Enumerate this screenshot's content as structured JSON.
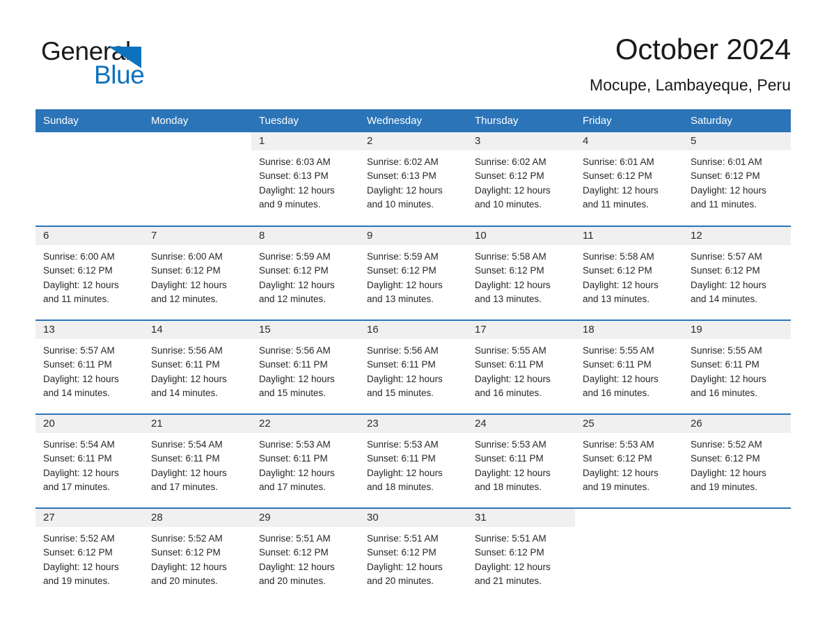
{
  "brand": {
    "logo_line1": "General",
    "logo_line2": "Blue",
    "logo_triangle": "blue-triangle-icon",
    "black": "#1a1a1a",
    "blue": "#0d72bd"
  },
  "header": {
    "month_title": "October 2024",
    "location": "Mocupe, Lambayeque, Peru"
  },
  "theme": {
    "header_blue": "#2b74b8",
    "row_rule_blue": "#2b74b8",
    "daynum_band": "#f0f0f0",
    "cell_bg": "#ffffff",
    "text": "#262626"
  },
  "calendar": {
    "weekday_headers": [
      "Sunday",
      "Monday",
      "Tuesday",
      "Wednesday",
      "Thursday",
      "Friday",
      "Saturday"
    ],
    "weeks": [
      [
        {
          "day": "",
          "lines": [
            "",
            "",
            "",
            ""
          ],
          "blank": true
        },
        {
          "day": "",
          "lines": [
            "",
            "",
            "",
            ""
          ],
          "blank": true
        },
        {
          "day": "1",
          "lines": [
            "Sunrise: 6:03 AM",
            "Sunset: 6:13 PM",
            "Daylight: 12 hours",
            "and 9 minutes."
          ]
        },
        {
          "day": "2",
          "lines": [
            "Sunrise: 6:02 AM",
            "Sunset: 6:13 PM",
            "Daylight: 12 hours",
            "and 10 minutes."
          ]
        },
        {
          "day": "3",
          "lines": [
            "Sunrise: 6:02 AM",
            "Sunset: 6:12 PM",
            "Daylight: 12 hours",
            "and 10 minutes."
          ]
        },
        {
          "day": "4",
          "lines": [
            "Sunrise: 6:01 AM",
            "Sunset: 6:12 PM",
            "Daylight: 12 hours",
            "and 11 minutes."
          ]
        },
        {
          "day": "5",
          "lines": [
            "Sunrise: 6:01 AM",
            "Sunset: 6:12 PM",
            "Daylight: 12 hours",
            "and 11 minutes."
          ]
        }
      ],
      [
        {
          "day": "6",
          "lines": [
            "Sunrise: 6:00 AM",
            "Sunset: 6:12 PM",
            "Daylight: 12 hours",
            "and 11 minutes."
          ]
        },
        {
          "day": "7",
          "lines": [
            "Sunrise: 6:00 AM",
            "Sunset: 6:12 PM",
            "Daylight: 12 hours",
            "and 12 minutes."
          ]
        },
        {
          "day": "8",
          "lines": [
            "Sunrise: 5:59 AM",
            "Sunset: 6:12 PM",
            "Daylight: 12 hours",
            "and 12 minutes."
          ]
        },
        {
          "day": "9",
          "lines": [
            "Sunrise: 5:59 AM",
            "Sunset: 6:12 PM",
            "Daylight: 12 hours",
            "and 13 minutes."
          ]
        },
        {
          "day": "10",
          "lines": [
            "Sunrise: 5:58 AM",
            "Sunset: 6:12 PM",
            "Daylight: 12 hours",
            "and 13 minutes."
          ]
        },
        {
          "day": "11",
          "lines": [
            "Sunrise: 5:58 AM",
            "Sunset: 6:12 PM",
            "Daylight: 12 hours",
            "and 13 minutes."
          ]
        },
        {
          "day": "12",
          "lines": [
            "Sunrise: 5:57 AM",
            "Sunset: 6:12 PM",
            "Daylight: 12 hours",
            "and 14 minutes."
          ]
        }
      ],
      [
        {
          "day": "13",
          "lines": [
            "Sunrise: 5:57 AM",
            "Sunset: 6:11 PM",
            "Daylight: 12 hours",
            "and 14 minutes."
          ]
        },
        {
          "day": "14",
          "lines": [
            "Sunrise: 5:56 AM",
            "Sunset: 6:11 PM",
            "Daylight: 12 hours",
            "and 14 minutes."
          ]
        },
        {
          "day": "15",
          "lines": [
            "Sunrise: 5:56 AM",
            "Sunset: 6:11 PM",
            "Daylight: 12 hours",
            "and 15 minutes."
          ]
        },
        {
          "day": "16",
          "lines": [
            "Sunrise: 5:56 AM",
            "Sunset: 6:11 PM",
            "Daylight: 12 hours",
            "and 15 minutes."
          ]
        },
        {
          "day": "17",
          "lines": [
            "Sunrise: 5:55 AM",
            "Sunset: 6:11 PM",
            "Daylight: 12 hours",
            "and 16 minutes."
          ]
        },
        {
          "day": "18",
          "lines": [
            "Sunrise: 5:55 AM",
            "Sunset: 6:11 PM",
            "Daylight: 12 hours",
            "and 16 minutes."
          ]
        },
        {
          "day": "19",
          "lines": [
            "Sunrise: 5:55 AM",
            "Sunset: 6:11 PM",
            "Daylight: 12 hours",
            "and 16 minutes."
          ]
        }
      ],
      [
        {
          "day": "20",
          "lines": [
            "Sunrise: 5:54 AM",
            "Sunset: 6:11 PM",
            "Daylight: 12 hours",
            "and 17 minutes."
          ]
        },
        {
          "day": "21",
          "lines": [
            "Sunrise: 5:54 AM",
            "Sunset: 6:11 PM",
            "Daylight: 12 hours",
            "and 17 minutes."
          ]
        },
        {
          "day": "22",
          "lines": [
            "Sunrise: 5:53 AM",
            "Sunset: 6:11 PM",
            "Daylight: 12 hours",
            "and 17 minutes."
          ]
        },
        {
          "day": "23",
          "lines": [
            "Sunrise: 5:53 AM",
            "Sunset: 6:11 PM",
            "Daylight: 12 hours",
            "and 18 minutes."
          ]
        },
        {
          "day": "24",
          "lines": [
            "Sunrise: 5:53 AM",
            "Sunset: 6:11 PM",
            "Daylight: 12 hours",
            "and 18 minutes."
          ]
        },
        {
          "day": "25",
          "lines": [
            "Sunrise: 5:53 AM",
            "Sunset: 6:12 PM",
            "Daylight: 12 hours",
            "and 19 minutes."
          ]
        },
        {
          "day": "26",
          "lines": [
            "Sunrise: 5:52 AM",
            "Sunset: 6:12 PM",
            "Daylight: 12 hours",
            "and 19 minutes."
          ]
        }
      ],
      [
        {
          "day": "27",
          "lines": [
            "Sunrise: 5:52 AM",
            "Sunset: 6:12 PM",
            "Daylight: 12 hours",
            "and 19 minutes."
          ]
        },
        {
          "day": "28",
          "lines": [
            "Sunrise: 5:52 AM",
            "Sunset: 6:12 PM",
            "Daylight: 12 hours",
            "and 20 minutes."
          ]
        },
        {
          "day": "29",
          "lines": [
            "Sunrise: 5:51 AM",
            "Sunset: 6:12 PM",
            "Daylight: 12 hours",
            "and 20 minutes."
          ]
        },
        {
          "day": "30",
          "lines": [
            "Sunrise: 5:51 AM",
            "Sunset: 6:12 PM",
            "Daylight: 12 hours",
            "and 20 minutes."
          ]
        },
        {
          "day": "31",
          "lines": [
            "Sunrise: 5:51 AM",
            "Sunset: 6:12 PM",
            "Daylight: 12 hours",
            "and 21 minutes."
          ]
        },
        {
          "day": "",
          "lines": [
            "",
            "",
            "",
            ""
          ],
          "blank": true
        },
        {
          "day": "",
          "lines": [
            "",
            "",
            "",
            ""
          ],
          "blank": true
        }
      ]
    ]
  }
}
